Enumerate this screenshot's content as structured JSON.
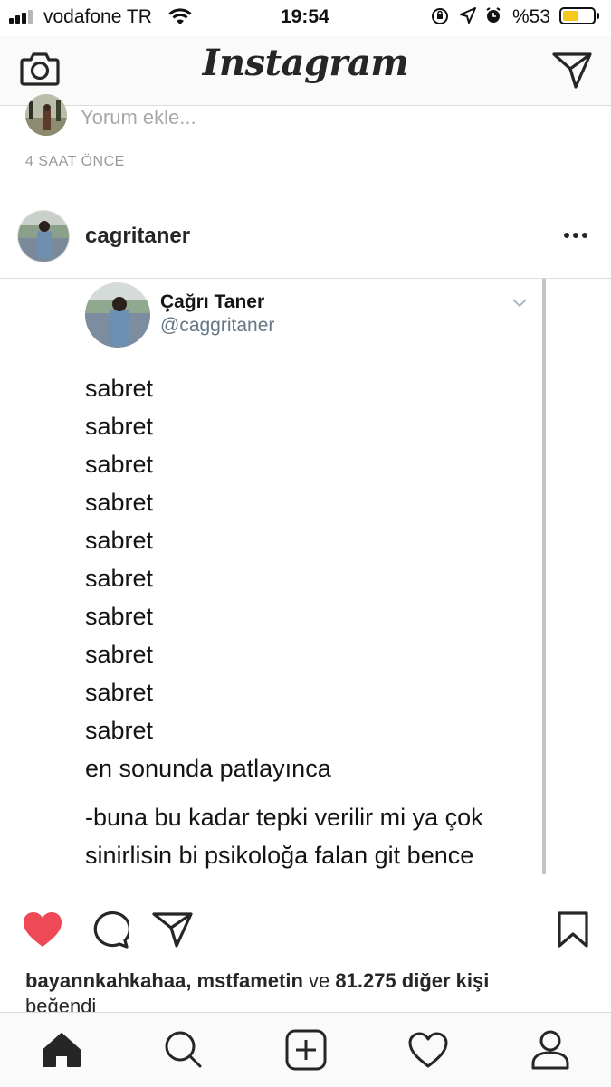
{
  "status_bar": {
    "carrier": "vodafone TR",
    "time": "19:54",
    "battery": "%53",
    "battery_level": 0.53
  },
  "header": {
    "logo": "Instagram",
    "camera_icon": "camera-icon",
    "direct_icon": "paper-plane-icon"
  },
  "prev_post": {
    "comment_placeholder": "Yorum ekle...",
    "time_ago": "4 SAAT ÖNCE"
  },
  "post": {
    "username": "cagritaner",
    "more_icon": "ellipsis-icon",
    "tweet": {
      "display_name": "Çağrı Taner",
      "handle": "@caggritaner",
      "lines": [
        "sabret",
        "sabret",
        "sabret",
        "sabret",
        "sabret",
        "sabret",
        "sabret",
        "sabret",
        "sabret",
        "sabret",
        "en sonunda patlayınca"
      ],
      "reply_lines": [
        "-buna bu kadar tepki verilir mi ya çok",
        "sinirlisin bi psikoloğa falan git bence"
      ]
    },
    "actions": {
      "like": "heart-icon",
      "comment": "comment-icon",
      "share": "paper-plane-icon",
      "save": "bookmark-icon",
      "liked_color": "#ed4956"
    },
    "likes": {
      "user1": "bayannkahkahaa",
      "sep": ", ",
      "user2": "mstfametin",
      "and": " ve ",
      "others": "81.275 diğer kişi",
      "liked_text": "beğendi"
    }
  },
  "tabbar": {
    "items": [
      "home-icon",
      "search-icon",
      "add-post-icon",
      "activity-icon",
      "profile-icon"
    ]
  }
}
